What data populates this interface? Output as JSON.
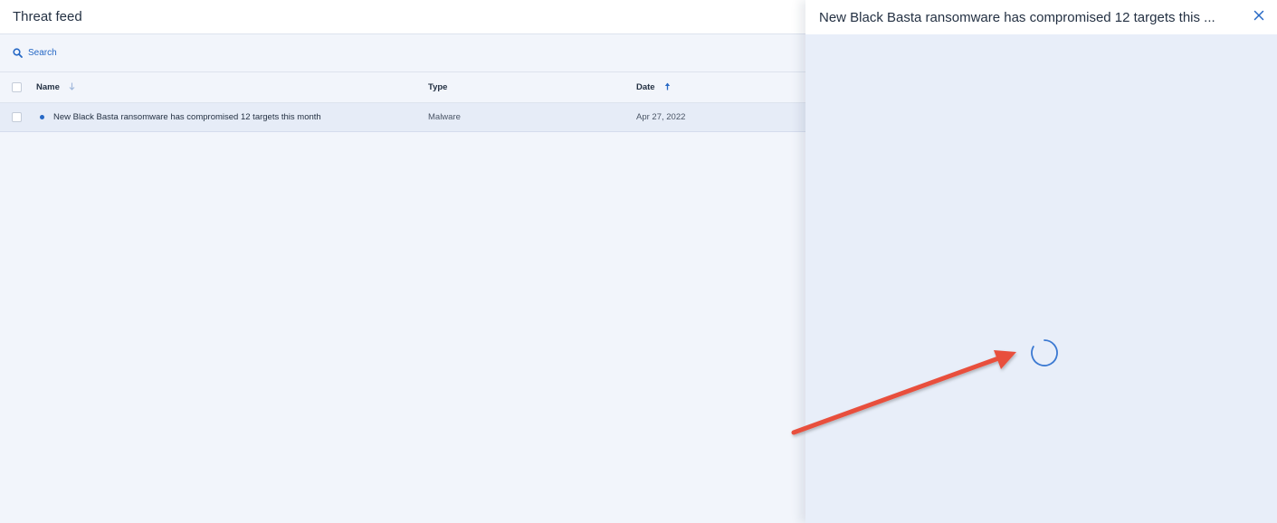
{
  "page": {
    "title": "Threat feed"
  },
  "toolbar": {
    "search_label": "Search"
  },
  "table": {
    "columns": {
      "name": "Name",
      "type": "Type",
      "date": "Date"
    },
    "rows": [
      {
        "name": "New Black Basta ransomware has compromised 12 targets this month",
        "type": "Malware",
        "date": "Apr 27, 2022",
        "unread": true
      }
    ]
  },
  "detail": {
    "title": "New Black Basta ransomware has compromised 12 targets this ...",
    "state": "loading"
  },
  "icons": {
    "search": "search-icon",
    "sort_name": "arrow-down-icon",
    "sort_date": "arrow-up-icon",
    "close": "close-icon",
    "loading": "spinner-icon",
    "annotation": "red-arrow"
  },
  "colors": {
    "accent": "#2668c5",
    "annotation_arrow": "#e8503e",
    "selected_row": "#e6ecf7"
  }
}
